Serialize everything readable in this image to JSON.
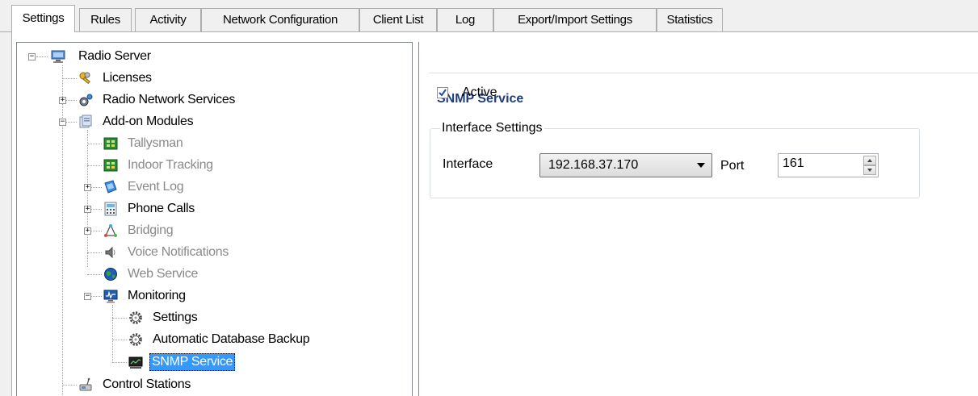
{
  "tabs": [
    {
      "label": "Settings",
      "active": true
    },
    {
      "label": "Rules"
    },
    {
      "label": "Activity"
    },
    {
      "label": "Network Configuration"
    },
    {
      "label": "Client List"
    },
    {
      "label": "Log"
    },
    {
      "label": "Export/Import Settings"
    },
    {
      "label": "Statistics"
    }
  ],
  "tree": {
    "items": [
      {
        "label": "Radio Server",
        "icon": "server-icon",
        "expander": "minus"
      },
      {
        "label": "Licenses",
        "icon": "keys-icon"
      },
      {
        "label": "Radio Network Services",
        "icon": "network-gear-icon",
        "expander": "plus"
      },
      {
        "label": "Add-on Modules",
        "icon": "modules-icon",
        "expander": "minus"
      },
      {
        "label": "Tallysman",
        "icon": "module-green-icon",
        "disabled": true
      },
      {
        "label": "Indoor Tracking",
        "icon": "module-green-icon",
        "disabled": true
      },
      {
        "label": "Event Log",
        "icon": "event-log-icon",
        "expander": "plus",
        "disabled": true
      },
      {
        "label": "Phone Calls",
        "icon": "phone-icon",
        "expander": "plus"
      },
      {
        "label": "Bridging",
        "icon": "bridging-icon",
        "expander": "plus",
        "disabled": true
      },
      {
        "label": "Voice Notifications",
        "icon": "speaker-icon",
        "disabled": true
      },
      {
        "label": "Web Service",
        "icon": "globe-icon",
        "disabled": true
      },
      {
        "label": "Monitoring",
        "icon": "monitor-icon",
        "expander": "minus"
      },
      {
        "label": "Settings",
        "icon": "cog-icon"
      },
      {
        "label": "Automatic Database Backup",
        "icon": "cog-icon"
      },
      {
        "label": "SNMP Service",
        "icon": "snmp-icon",
        "selected": true
      },
      {
        "label": "Control Stations",
        "icon": "control-station-icon"
      }
    ]
  },
  "panel": {
    "title": "SNMP Service",
    "active_label": "Active",
    "active_checked": true,
    "group_title": "Interface Settings",
    "interface_label": "Interface",
    "interface_value": "192.168.37.170",
    "port_label": "Port",
    "port_value": "161"
  },
  "colors": {
    "selection": "#3399ff",
    "section_title": "#1f3d7a",
    "disabled_text": "#8a8a8a"
  }
}
